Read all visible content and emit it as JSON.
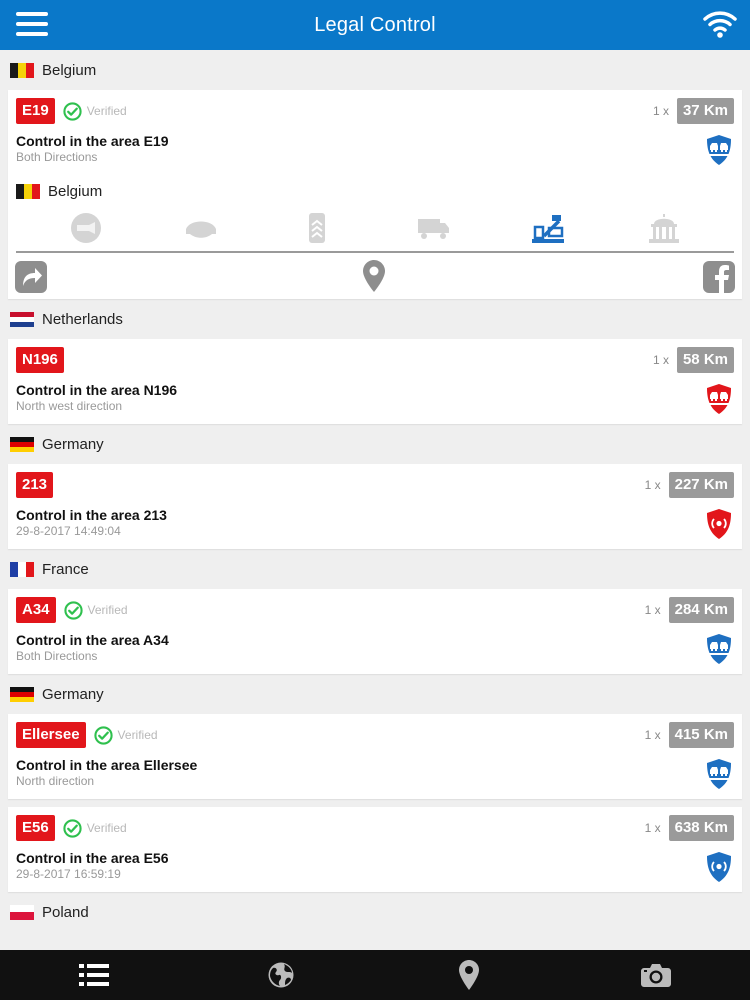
{
  "header": {
    "title": "Legal Control"
  },
  "verified_label": "Verified",
  "colors": {
    "header": "#0a78c9",
    "road": "#e2161b",
    "km": "#9a9a9a",
    "shield_blue": "#1e6fc1",
    "shield_red": "#e2161b",
    "verified_green": "#2fc04e"
  },
  "groups": [
    {
      "country": "Belgium",
      "flag": "belgium",
      "cards": [
        {
          "road": "E19",
          "verified": true,
          "multiplier": "1 x",
          "km": "37 Km",
          "title": "Control in the area E19",
          "subtitle": "Both Directions",
          "shield": "blue-cars-icon",
          "expanded": {
            "country": "Belgium",
            "category_icons": [
              "speed-camera-icon",
              "police-cap-icon",
              "rank-insignia-icon",
              "truck-icon",
              "customs-control-icon",
              "government-building-icon"
            ],
            "active_category": "customs-control-icon"
          }
        }
      ]
    },
    {
      "country": "Netherlands",
      "flag": "netherlands",
      "cards": [
        {
          "road": "N196",
          "verified": false,
          "multiplier": "1 x",
          "km": "58 Km",
          "title": "Control in the area N196",
          "subtitle": "North west direction",
          "shield": "red-cars-icon"
        }
      ]
    },
    {
      "country": "Germany",
      "flag": "germany",
      "cards": [
        {
          "road": "213",
          "verified": false,
          "multiplier": "1 x",
          "km": "227 Km",
          "title": "Control in the area 213",
          "subtitle": "29-8-2017 14:49:04",
          "shield": "red-radar-icon"
        }
      ]
    },
    {
      "country": "France",
      "flag": "france",
      "cards": [
        {
          "road": "A34",
          "verified": true,
          "multiplier": "1 x",
          "km": "284 Km",
          "title": "Control in the area A34",
          "subtitle": "Both Directions",
          "shield": "blue-cars-icon"
        }
      ]
    },
    {
      "country": "Germany",
      "flag": "germany",
      "cards": [
        {
          "road": "Ellersee",
          "verified": true,
          "multiplier": "1 x",
          "km": "415 Km",
          "title": "Control in the area Ellersee",
          "subtitle": "North direction",
          "shield": "blue-cars-icon"
        },
        {
          "road": "E56",
          "verified": true,
          "multiplier": "1 x",
          "km": "638 Km",
          "title": "Control in the area E56",
          "subtitle": "29-8-2017 16:59:19",
          "shield": "blue-radar-icon"
        }
      ]
    },
    {
      "country": "Poland",
      "flag": "poland",
      "cards": []
    }
  ],
  "bottom_nav": [
    "list-icon",
    "globe-icon",
    "map-pin-icon",
    "camera-icon"
  ]
}
